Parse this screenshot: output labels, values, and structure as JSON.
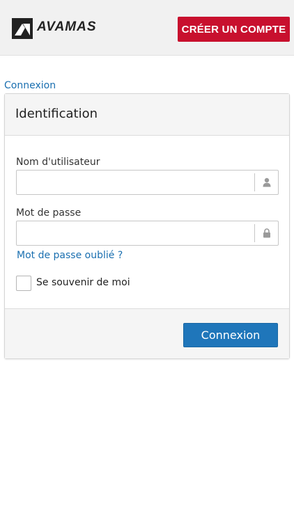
{
  "header": {
    "brand": "AVAMAS",
    "create_account_label": "CRÉER UN COMPTE"
  },
  "breadcrumb": {
    "label": "Connexion"
  },
  "panel": {
    "title": "Identification",
    "username": {
      "label": "Nom d'utilisateur",
      "value": "",
      "icon": "user-icon"
    },
    "password": {
      "label": "Mot de passe",
      "value": "",
      "icon": "lock-icon"
    },
    "forgot_label": "Mot de passe oublié ?",
    "remember_label": "Se souvenir de moi",
    "remember_checked": false,
    "submit_label": "Connexion"
  },
  "colors": {
    "accent_red": "#c8102e",
    "accent_blue": "#1f76ba",
    "link_blue": "#1a6fb0"
  }
}
